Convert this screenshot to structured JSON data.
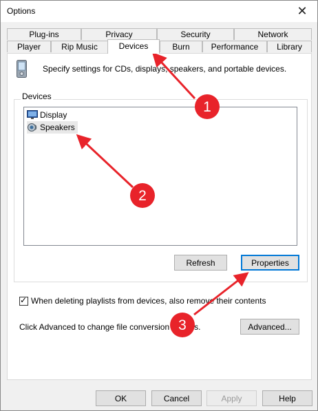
{
  "window": {
    "title": "Options",
    "close_glyph": "✕"
  },
  "tabs": {
    "row1": [
      "Plug-ins",
      "Privacy",
      "Security",
      "Network"
    ],
    "row2": [
      "Player",
      "Rip Music",
      "Devices",
      "Burn",
      "Performance",
      "Library"
    ],
    "active": "Devices"
  },
  "devices_page": {
    "description": "Specify settings for CDs, displays, speakers, and portable devices.",
    "group_label": "Devices",
    "items": [
      {
        "label": "Display",
        "icon": "monitor-icon",
        "selected": false
      },
      {
        "label": "Speakers",
        "icon": "speaker-icon",
        "selected": true
      }
    ],
    "refresh_label": "Refresh",
    "properties_label": "Properties",
    "checkbox_label": "When deleting playlists from devices, also remove their contents",
    "checkbox_checked": true,
    "advanced_text": "Click Advanced to change file conversion options.",
    "advanced_label": "Advanced..."
  },
  "footer": {
    "ok": "OK",
    "cancel": "Cancel",
    "apply": "Apply",
    "help": "Help"
  },
  "annotations": [
    "1",
    "2",
    "3"
  ],
  "colors": {
    "accent": "#0078d7",
    "annotation": "#e8232a"
  }
}
